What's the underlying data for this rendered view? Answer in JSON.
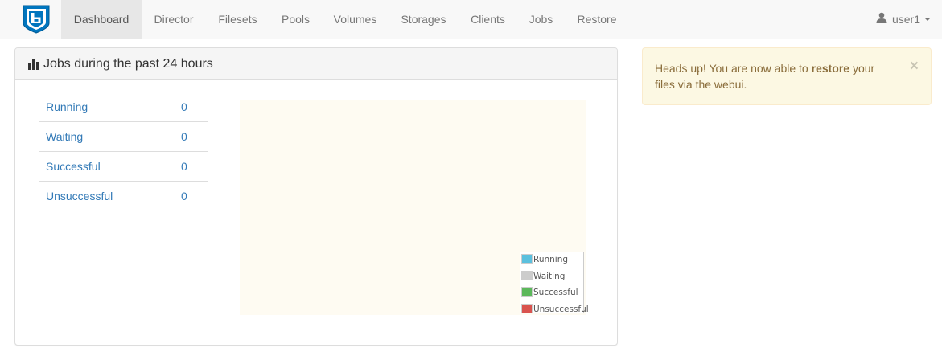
{
  "navbar": {
    "brand_icon": "bareos-logo-icon",
    "items": [
      {
        "label": "Dashboard",
        "active": true
      },
      {
        "label": "Director"
      },
      {
        "label": "Filesets"
      },
      {
        "label": "Pools"
      },
      {
        "label": "Volumes"
      },
      {
        "label": "Storages"
      },
      {
        "label": "Clients"
      },
      {
        "label": "Jobs"
      },
      {
        "label": "Restore"
      }
    ],
    "user": {
      "label": "user1",
      "icon": "user-icon"
    }
  },
  "panel": {
    "title": "Jobs during the past 24 hours",
    "icon": "bar-chart-icon",
    "status_rows": [
      {
        "label": "Running",
        "count": "0"
      },
      {
        "label": "Waiting",
        "count": "0"
      },
      {
        "label": "Successful",
        "count": "0"
      },
      {
        "label": "Unsuccessful",
        "count": "0"
      }
    ]
  },
  "chart_data": {
    "type": "pie",
    "categories": [
      "Running",
      "Waiting",
      "Successful",
      "Unsuccessful"
    ],
    "values": [
      0,
      0,
      0,
      0
    ],
    "colors": [
      "#5bc0de",
      "#cccccc",
      "#5cb85c",
      "#d9534f"
    ],
    "legend": {
      "placement": "bottom-right",
      "entries": [
        "Running",
        "Waiting",
        "Successful",
        "Unsuccessful"
      ]
    }
  },
  "alert": {
    "text_before": "Heads up! You are now able to ",
    "text_bold": "restore",
    "text_after": " your files via the webui.",
    "close_label": "×"
  }
}
